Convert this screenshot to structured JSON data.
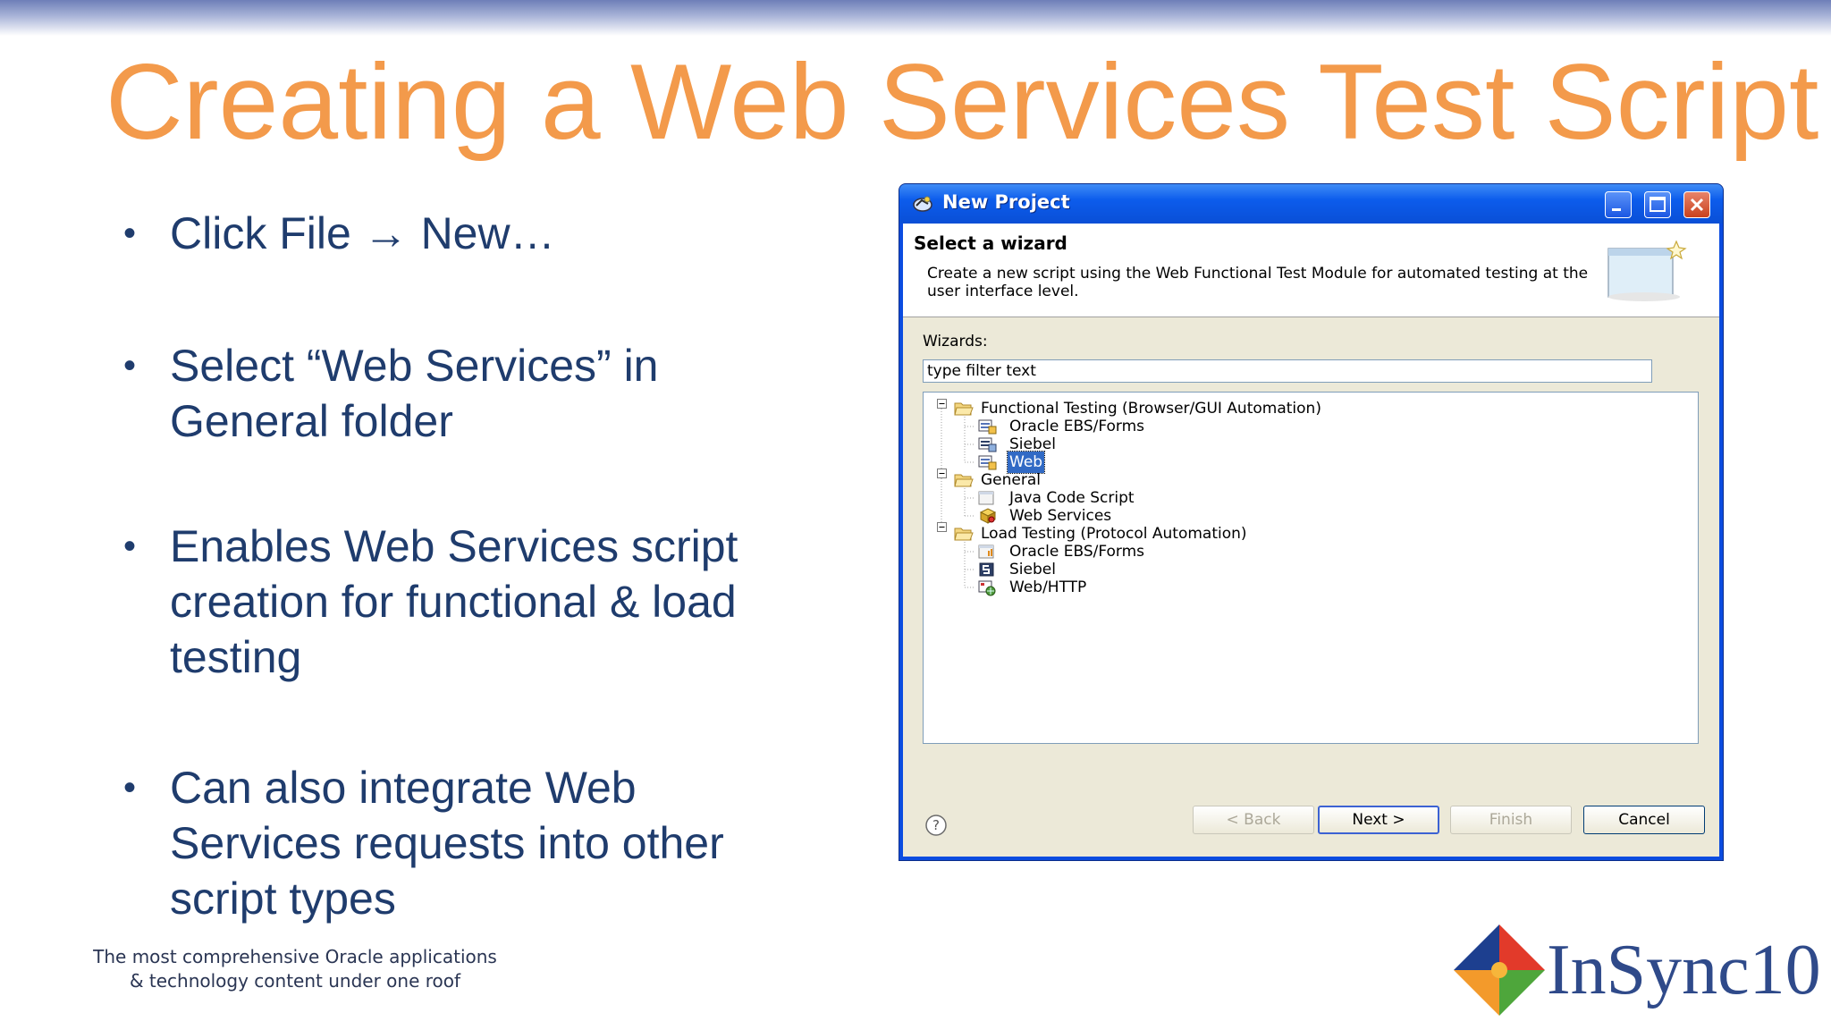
{
  "slide": {
    "title": "Creating a Web Services Test Script",
    "bullets": [
      "Click File → New…",
      "Select “Web Services” in General folder",
      "Enables Web Services script creation for functional & load testing",
      "Can also integrate Web Services requests into other script types"
    ],
    "bullet_char": "•",
    "footer": "The most comprehensive Oracle applications & technology content under one roof",
    "logo_text": "InSync10",
    "title_color": "#f39a4b",
    "text_color": "#1f3c6d"
  },
  "dialog": {
    "title": "New Project",
    "header_title": "Select a wizard",
    "header_desc": "Create a new script using the Web Functional Test Module for automated testing at the user interface level.",
    "wizards_label": "Wizards:",
    "filter_value": "type filter text",
    "tree": [
      {
        "label": "Functional Testing (Browser/GUI Automation)",
        "type": "folder"
      },
      {
        "label": "Oracle EBS/Forms",
        "type": "item"
      },
      {
        "label": "Siebel",
        "type": "item"
      },
      {
        "label": "Web",
        "type": "item",
        "selected": true
      },
      {
        "label": "General",
        "type": "folder"
      },
      {
        "label": "Java Code Script",
        "type": "item"
      },
      {
        "label": "Web Services",
        "type": "item"
      },
      {
        "label": "Load Testing (Protocol Automation)",
        "type": "folder"
      },
      {
        "label": "Oracle EBS/Forms",
        "type": "item"
      },
      {
        "label": "Siebel",
        "type": "item"
      },
      {
        "label": "Web/HTTP",
        "type": "item"
      }
    ],
    "buttons": {
      "back": "< Back",
      "next": "Next >",
      "finish": "Finish",
      "cancel": "Cancel"
    },
    "icons": {
      "title": "project-wizard-icon",
      "help": "help-icon",
      "folder": "folder-open-icon"
    }
  }
}
